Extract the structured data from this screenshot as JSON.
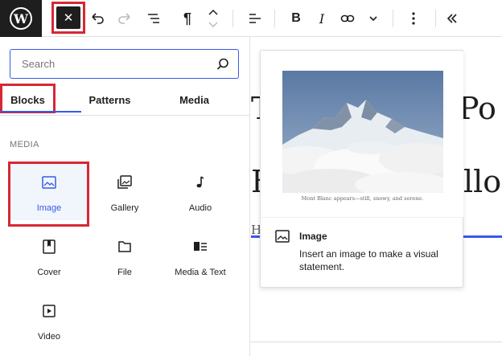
{
  "toolbar": {
    "logo_glyph": "W",
    "close_glyph": "✕",
    "paragraph_glyph": "¶",
    "bold_glyph": "B",
    "italic_glyph": "I"
  },
  "inserter": {
    "search_placeholder": "Search",
    "tabs": [
      "Blocks",
      "Patterns",
      "Media"
    ],
    "category": "MEDIA",
    "blocks": [
      {
        "label": "Image",
        "icon": "image-icon"
      },
      {
        "label": "Gallery",
        "icon": "gallery-icon"
      },
      {
        "label": "Audio",
        "icon": "audio-icon"
      },
      {
        "label": "Cover",
        "icon": "cover-icon"
      },
      {
        "label": "File",
        "icon": "file-icon"
      },
      {
        "label": "Media & Text",
        "icon": "media-text-icon"
      },
      {
        "label": "Video",
        "icon": "video-icon"
      }
    ]
  },
  "canvas": {
    "line1_left": "T",
    "line1_right": "Po",
    "line2_left": "F",
    "line2_right": "llo",
    "small_text": "H"
  },
  "preview": {
    "caption": "Mont Blanc appears—still, snowy, and serene.",
    "title": "Image",
    "description": "Insert an image to make a visual statement."
  },
  "colors": {
    "accent": "#3858e9",
    "highlight_box": "#d62833",
    "dark": "#1e1e1e"
  }
}
